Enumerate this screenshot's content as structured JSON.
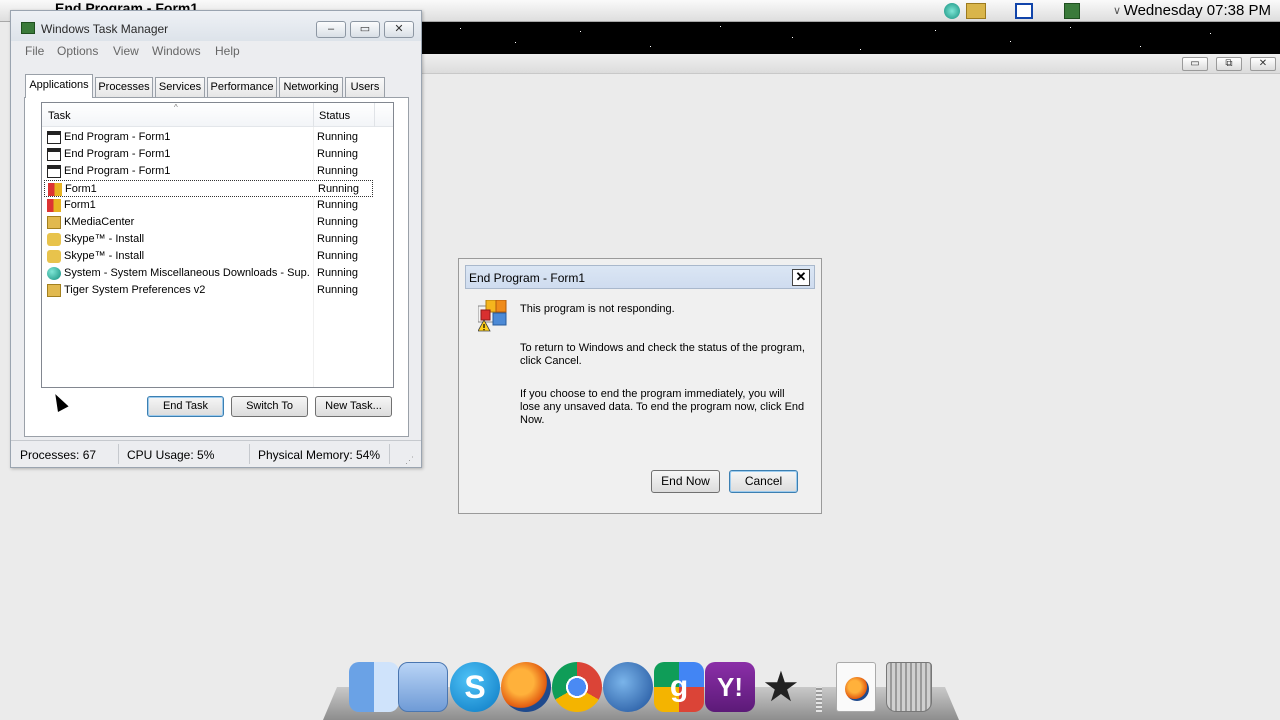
{
  "top_bar": {
    "title": "End Program - Form1",
    "clock": "Wednesday 07:38 PM"
  },
  "task_manager": {
    "title": "Windows Task Manager",
    "menu": [
      "File",
      "Options",
      "View",
      "Windows",
      "Help"
    ],
    "tabs": [
      "Applications",
      "Processes",
      "Services",
      "Performance",
      "Networking",
      "Users"
    ],
    "active_tab": "Applications",
    "columns": {
      "task": "Task",
      "status": "Status"
    },
    "rows": [
      {
        "task": "End Program - Form1",
        "status": "Running",
        "icon": "window-icon"
      },
      {
        "task": "End Program - Form1",
        "status": "Running",
        "icon": "window-icon"
      },
      {
        "task": "End Program - Form1",
        "status": "Running",
        "icon": "window-icon"
      },
      {
        "task": "Form1",
        "status": "Running",
        "icon": "form-icon",
        "selected": true
      },
      {
        "task": "Form1",
        "status": "Running",
        "icon": "form-icon"
      },
      {
        "task": "KMediaCenter",
        "status": "Running",
        "icon": "folder-icon"
      },
      {
        "task": "Skype™ - Install",
        "status": "Running",
        "icon": "skype-install-icon"
      },
      {
        "task": "Skype™ - Install",
        "status": "Running",
        "icon": "skype-install-icon"
      },
      {
        "task": "System - System Miscellaneous Downloads - Sup...",
        "status": "Running",
        "icon": "globe-icon"
      },
      {
        "task": "Tiger System Preferences v2",
        "status": "Running",
        "icon": "folder-icon"
      }
    ],
    "buttons": {
      "end_task": "End Task",
      "switch_to": "Switch To",
      "new_task": "New Task..."
    },
    "status_bar": {
      "processes": "Processes: 67",
      "cpu": "CPU Usage: 5%",
      "memory": "Physical Memory: 54%"
    }
  },
  "end_program_dialog": {
    "title": "End Program - Form1",
    "close": "✕",
    "message1": "This program is not responding.",
    "message2": "To return to Windows and check the status of the program, click Cancel.",
    "message3": "If you choose to end the program immediately, you will lose any unsaved data. To end the program now, click End Now.",
    "end_now": "End Now",
    "cancel": "Cancel"
  },
  "dock": {
    "icons": [
      "finder-icon",
      "network-app-icon",
      "skype-icon",
      "firefox-icon",
      "chrome-icon",
      "thunderbird-icon",
      "google-icon",
      "yahoo-messenger-icon",
      "imovie-star-icon",
      "firefox-document-icon",
      "trash-icon"
    ]
  },
  "colors": {
    "selection_border": "#333333",
    "dialog_titlebar": "#cfdcef",
    "default_button_border": "#3c7fb1"
  }
}
